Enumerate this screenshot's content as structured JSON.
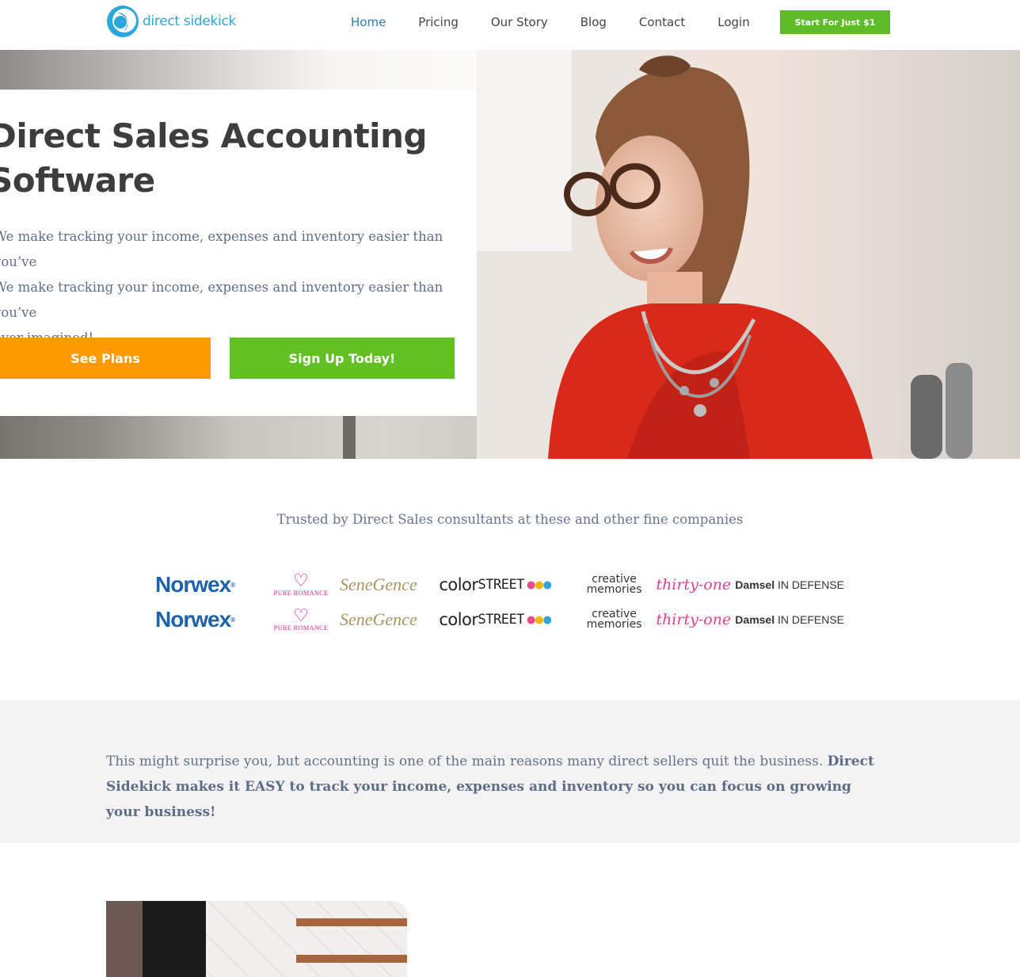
{
  "header": {
    "logo_text": "direct sidekick",
    "nav": [
      "Home",
      "Pricing",
      "Our Story",
      "Blog",
      "Contact",
      "Login"
    ],
    "active_nav": "Home",
    "cta_label": "Start For Just $1"
  },
  "hero": {
    "title_line1": "Direct Sales Accounting",
    "title_line2": "Software",
    "subtitle_line1": "We make tracking your income, expenses and inventory easier than you’ve",
    "subtitle_line2": "We make tracking your income, expenses and inventory easier than you’ve",
    "subtitle_line3": "ever imagined!",
    "btn_plans": "See Plans",
    "btn_signup": "Sign Up Today!"
  },
  "trusted": {
    "heading": "Trusted by Direct Sales consultants at these and other fine companies",
    "logos": {
      "norwex": "Norwex",
      "pure_romance": "PURE ROMANCE",
      "senegence": "SeneGence",
      "colorstreet_a": "color",
      "colorstreet_b": "STREET",
      "creative_a": "creative",
      "creative_b": "memories",
      "thirtyone": "thirty-one",
      "damsel_a": "Damsel",
      "damsel_b": "IN DEFENSE"
    }
  },
  "intro": {
    "plain": "This might surprise you, but accounting is one of the main reasons many direct sellers quit the business.",
    "bold": "Direct Sidekick makes it EASY to track your income, expenses and inventory so you can focus on growing your business!"
  },
  "colors": {
    "brand_blue": "#2aa7dc",
    "cta_green": "#5fbb27",
    "btn_orange": "#fd9a00",
    "text_slate": "#63728a"
  }
}
